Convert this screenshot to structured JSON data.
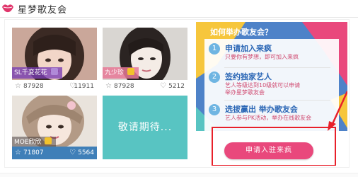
{
  "header": {
    "title": "星梦歌友会",
    "logo_icon": "lips-logo-icon"
  },
  "cards": [
    {
      "name": "SL千変花花",
      "stars": "87928",
      "fans": "11911"
    },
    {
      "name": "九少珍",
      "stars": "87928",
      "fans": "5212"
    },
    {
      "name": "MOE欣欣",
      "stars": "71807",
      "fans": "5564"
    }
  ],
  "placeholder": {
    "label": "敬请期待..."
  },
  "panel": {
    "title": "如何举办歌友会？",
    "steps": [
      {
        "num": "1",
        "title": "申请加入来疯",
        "desc": "只要你有梦想，即可加入来疯"
      },
      {
        "num": "2",
        "title": "签约独家艺人",
        "desc": "艺人等级达到10级就可以申请\n举办星梦歌友会"
      },
      {
        "num": "3",
        "title": "选拔赢出 举办歌友会",
        "desc": "艺人参与PK活动，举办在线歌友会"
      }
    ],
    "button_label": "申请入驻来疯"
  },
  "colors": {
    "accent": "#e9487c",
    "panel_blue": "#4e82c8",
    "teal_tile": "#58c4c2",
    "annotation_red": "#e8202a"
  }
}
